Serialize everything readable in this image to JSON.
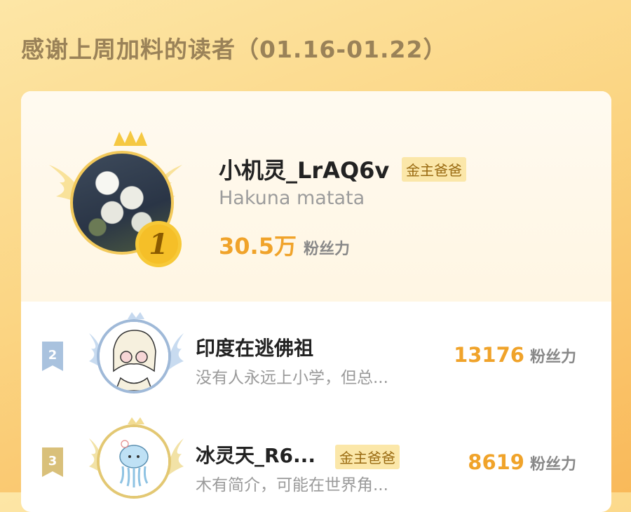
{
  "header": {
    "title": "感谢上周加料的读者（01.16-01.22）"
  },
  "colors": {
    "accent": "#f0a32a",
    "gold": "#f2c95b",
    "silver": "#a9c2de",
    "bronze": "#d9c07a"
  },
  "leaderboard": [
    {
      "rank": "1",
      "name": "小机灵_LrAQ6v",
      "badge": "金主爸爸",
      "bio": "Hakuna matata",
      "fans": "30.5万",
      "fans_label": "粉丝力",
      "avatar_icon": "flower-photo"
    },
    {
      "rank": "2",
      "name": "印度在逃佛祖",
      "bio": "没有人永远上小学，但总...",
      "fans": "13176",
      "fans_label": "粉丝力",
      "avatar_icon": "anime-character"
    },
    {
      "rank": "3",
      "name": "冰灵天_R6...",
      "badge": "金主爸爸",
      "bio": "木有简介，可能在世界角...",
      "fans": "8619",
      "fans_label": "粉丝力",
      "avatar_icon": "jellyfish-cartoon"
    }
  ]
}
